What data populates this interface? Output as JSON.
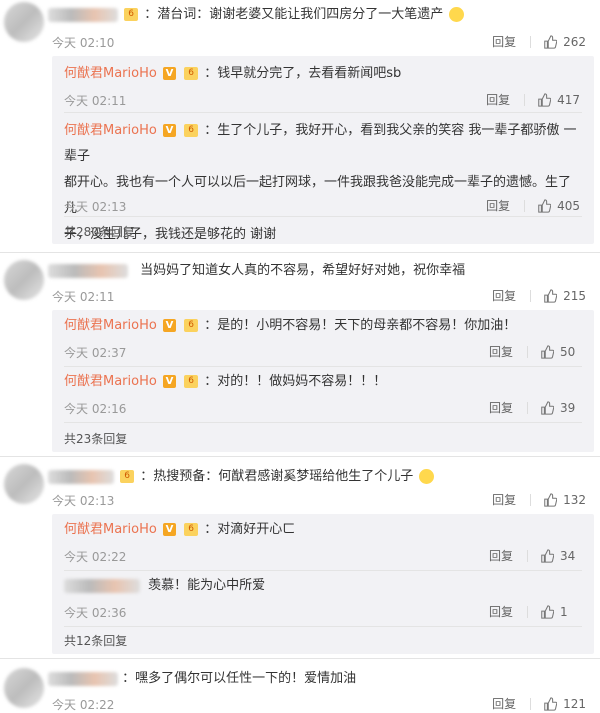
{
  "comments": [
    {
      "text_prefix": "：潜台词：谢谢老婆又能让我们四房分了一大笔遗产",
      "time": "今天 02:10",
      "reply": "回复",
      "likes": "262",
      "subs": [
        {
          "name": "何猷君MarioHo",
          "text": "：钱早就分完了，去看看新闻吧sb",
          "time": "今天 02:11",
          "reply": "回复",
          "likes": "417"
        },
        {
          "name": "何猷君MarioHo",
          "text1": "：生了个儿子，我好开心，看到我父亲的笑容 我一辈子都骄傲 一辈子",
          "text2": "都开心。我也有一个人可以以后一起打网球，一件我跟我爸没能完成一辈子的遗憾。生了儿",
          "text3": "子，没生儿子，我钱还是够花的 谢谢",
          "time": "今天 02:13",
          "reply": "回复",
          "likes": "405"
        }
      ],
      "more": "共280条回复"
    },
    {
      "text": "当妈妈了知道女人真的不容易，希望好好对她，祝你幸福",
      "time": "今天 02:11",
      "reply": "回复",
      "likes": "215",
      "subs": [
        {
          "name": "何猷君MarioHo",
          "text": "：是的！小明不容易！天下的母亲都不容易！你加油！",
          "time": "今天 02:37",
          "reply": "回复",
          "likes": "50"
        },
        {
          "name": "何猷君MarioHo",
          "text": "：对的！！做妈妈不容易！！！",
          "time": "今天 02:16",
          "reply": "回复",
          "likes": "39"
        }
      ],
      "more": "共23条回复"
    },
    {
      "text": "：热搜预备：何猷君感谢奚梦瑶给他生了个儿子",
      "time": "今天 02:13",
      "reply": "回复",
      "likes": "132",
      "subs": [
        {
          "name": "何猷君MarioHo",
          "text": "：对滴好开心ㄈ",
          "time": "今天 02:22",
          "reply": "回复",
          "likes": "34"
        },
        {
          "text": "羡慕！能为心中所爱",
          "time": "今天 02:36",
          "reply": "回复",
          "likes": "1"
        }
      ],
      "more": "共12条回复"
    },
    {
      "text": "：嘿多了偶尔可以任性一下的！爱情加油",
      "time": "今天 02:22",
      "reply": "回复",
      "likes": "121"
    }
  ],
  "badges": {
    "v": "V",
    "rank": "6"
  },
  "icons": {
    "like": "thumbs-up-icon",
    "emoji": "smile-emoji-icon"
  }
}
